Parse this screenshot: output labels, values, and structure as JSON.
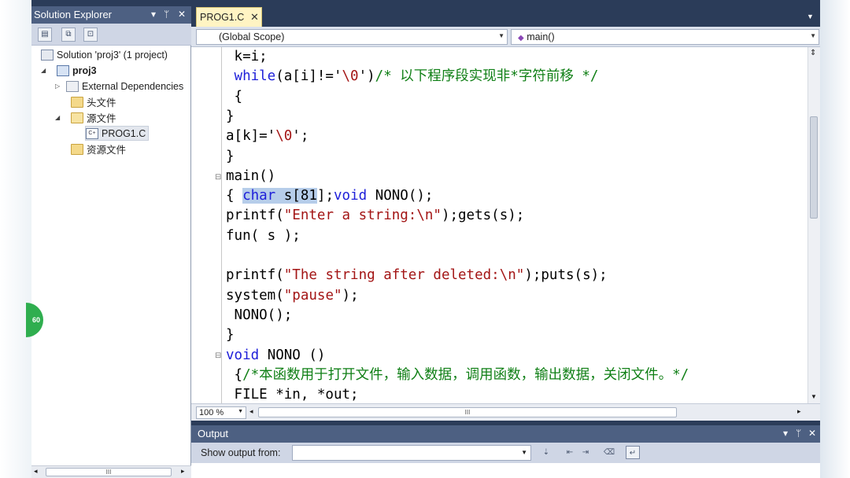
{
  "solution_explorer": {
    "title": "Solution Explorer",
    "pin_glyph": "▾ ⊥ ✕",
    "items": [
      {
        "label": "Solution 'proj3' (1 project)",
        "icon": "solution-icon"
      },
      {
        "label": "proj3",
        "icon": "project-icon",
        "bold": true
      },
      {
        "label": "External Dependencies",
        "icon": "dependencies-icon"
      },
      {
        "label": "头文件",
        "icon": "folder-icon"
      },
      {
        "label": "源文件",
        "icon": "folder-open-icon"
      },
      {
        "label": "PROG1.C",
        "icon": "c-file-icon",
        "selected": true
      },
      {
        "label": "资源文件",
        "icon": "folder-icon"
      }
    ]
  },
  "editor": {
    "tab_label": "PROG1.C",
    "tab_close": "✕",
    "scope_combo": "(Global Scope)",
    "member_combo": "main()",
    "zoom": "100 %",
    "hscroll_grip": "III",
    "lines": [
      {
        "segs": [
          {
            "t": " k=i;",
            "c": ""
          }
        ]
      },
      {
        "segs": [
          {
            "t": " while",
            "c": "kw"
          },
          {
            "t": "(a[i]!='",
            "c": ""
          },
          {
            "t": "\\0",
            "c": "str"
          },
          {
            "t": "')",
            "c": ""
          },
          {
            "t": "/* 以下程序段实现非*字符前移 */",
            "c": "cmt"
          }
        ]
      },
      {
        "segs": [
          {
            "t": " {",
            "c": ""
          }
        ]
      },
      {
        "segs": [
          {
            "t": "}",
            "c": ""
          }
        ]
      },
      {
        "segs": [
          {
            "t": "a[k]='",
            "c": ""
          },
          {
            "t": "\\0",
            "c": "str"
          },
          {
            "t": "';",
            "c": ""
          }
        ]
      },
      {
        "segs": [
          {
            "t": "}",
            "c": ""
          }
        ]
      },
      {
        "segs": [
          {
            "t": "main()",
            "c": ""
          }
        ]
      },
      {
        "segs": [
          {
            "t": "{ ",
            "c": ""
          },
          {
            "t": "char",
            "c": "kw sel"
          },
          {
            "t": " s[81",
            "c": "sel"
          },
          {
            "t": "];",
            "c": ""
          },
          {
            "t": "void",
            "c": "kw"
          },
          {
            "t": " NONO();",
            "c": ""
          }
        ]
      },
      {
        "segs": [
          {
            "t": "printf(",
            "c": ""
          },
          {
            "t": "\"Enter a string:\\n\"",
            "c": "str"
          },
          {
            "t": ");gets(s);",
            "c": ""
          }
        ]
      },
      {
        "segs": [
          {
            "t": "fun( s );",
            "c": ""
          }
        ]
      },
      {
        "segs": [
          {
            "t": "",
            "c": ""
          }
        ]
      },
      {
        "segs": [
          {
            "t": "printf(",
            "c": ""
          },
          {
            "t": "\"The string after deleted:\\n\"",
            "c": "str"
          },
          {
            "t": ");puts(s);",
            "c": ""
          }
        ]
      },
      {
        "segs": [
          {
            "t": "system(",
            "c": ""
          },
          {
            "t": "\"pause\"",
            "c": "str"
          },
          {
            "t": ");",
            "c": ""
          }
        ]
      },
      {
        "segs": [
          {
            "t": " NONO();",
            "c": ""
          }
        ]
      },
      {
        "segs": [
          {
            "t": "}",
            "c": ""
          }
        ]
      },
      {
        "segs": [
          {
            "t": "void",
            "c": "kw"
          },
          {
            "t": " NONO ()",
            "c": ""
          }
        ]
      },
      {
        "segs": [
          {
            "t": " {",
            "c": ""
          },
          {
            "t": "/*本函数用于打开文件，输入数据，调用函数，输出数据，关闭文件。*/",
            "c": "cmt"
          }
        ]
      },
      {
        "segs": [
          {
            "t": " FILE *in, *out;",
            "c": ""
          }
        ]
      }
    ]
  },
  "output": {
    "title": "Output",
    "show_from_label": "Show output from:",
    "show_from_value": ""
  },
  "badge": "60",
  "colors": {
    "title_bar": "#4d6082",
    "keyword": "#1f20d9",
    "string": "#a31515",
    "comment": "#0f7f15",
    "selection": "#b6cdea"
  }
}
